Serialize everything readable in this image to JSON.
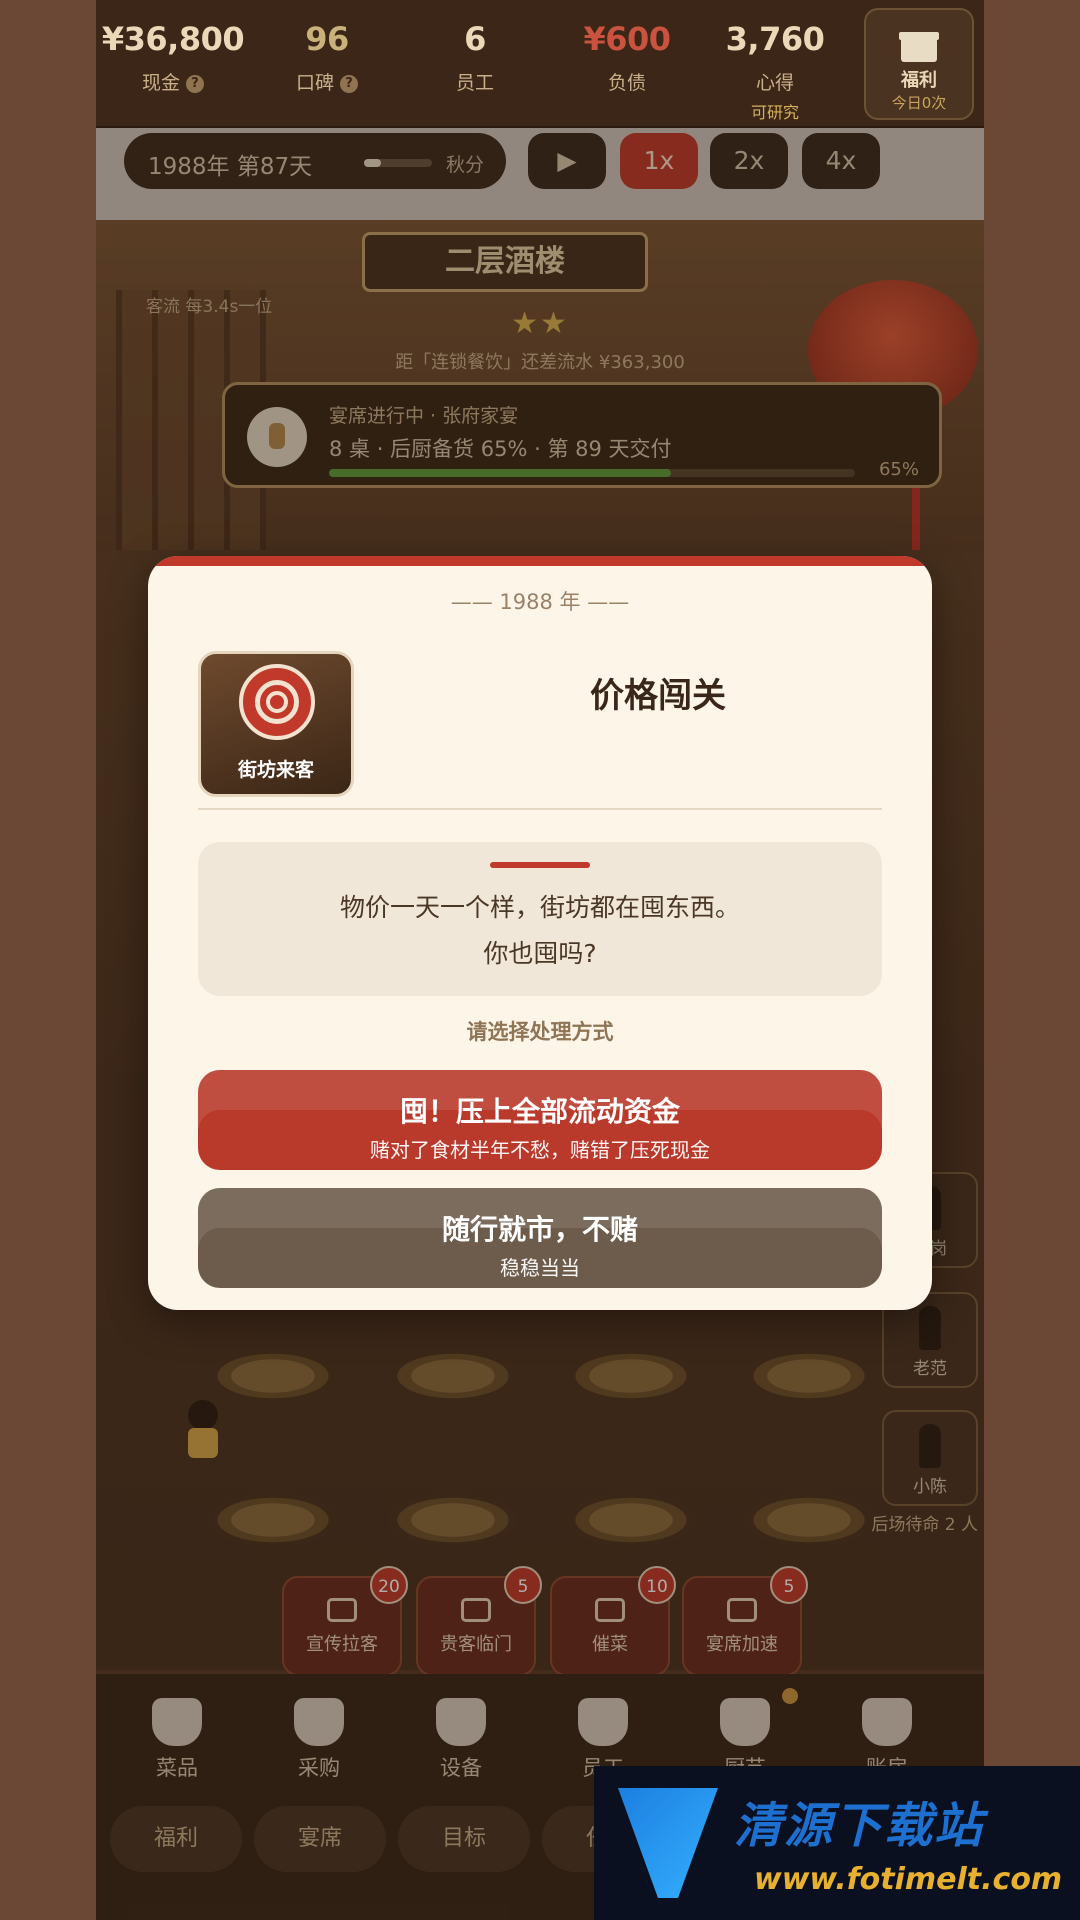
{
  "stats": [
    {
      "value": "¥36,800",
      "label": "现金",
      "help": "?"
    },
    {
      "value": "96",
      "label": "口碑",
      "help": "?"
    },
    {
      "value": "6",
      "label": "员工"
    },
    {
      "value": "¥600",
      "label": "负债"
    },
    {
      "value": "3,760",
      "label": "心得",
      "sub": "可研究"
    }
  ],
  "gift": {
    "label": "福利",
    "sub": "今日0次"
  },
  "timebar": {
    "date": "1988年 第87天",
    "season": "秋分",
    "season_progress": 0.25,
    "play": "▶",
    "speeds": [
      "1x",
      "2x",
      "4x"
    ],
    "active_speed": "1x"
  },
  "scene": {
    "restaurant_name": "二层酒楼",
    "traffic": "客流 每3.4s一位",
    "stars": "★★",
    "goal_gap": "距「连锁餐饮」还差流水 ¥363,300",
    "banquet": {
      "title": "宴席进行中 · 张府家宴",
      "detail": "8 桌 · 后厨备货 65% · 第 89 天交付",
      "progress": 0.65,
      "pct": "65%"
    },
    "staff": [
      {
        "name": "在岗"
      },
      {
        "name": "老范"
      },
      {
        "name": "小陈"
      }
    ],
    "waiting": "后场待命 2 人",
    "boosts": [
      {
        "label": "宣传拉客",
        "count": "20"
      },
      {
        "label": "贵客临门",
        "count": "5"
      },
      {
        "label": "催菜",
        "count": "10"
      },
      {
        "label": "宴席加速",
        "count": "5"
      }
    ]
  },
  "nav": {
    "items": [
      "菜品",
      "采购",
      "设备",
      "员工",
      "厨艺",
      "账房"
    ],
    "subtabs": [
      "福利",
      "宴席",
      "目标",
      "任务"
    ]
  },
  "modal": {
    "year": "—— 1988 年 ——",
    "image_caption": "街坊来客",
    "title": "价格闯关",
    "desc_line1": "物价一天一个样，街坊都在囤东西。",
    "desc_line2": "你也囤吗?",
    "prompt": "请选择处理方式",
    "choices": [
      {
        "main": "囤！压上全部流动资金",
        "sub": "赌对了食材半年不愁，赌错了压死现金"
      },
      {
        "main": "随行就市，不赌",
        "sub": "稳稳当当"
      }
    ]
  },
  "watermark": {
    "name": "清源下载站",
    "url": "www.fotimelt.com"
  },
  "colors": {
    "accent": "#c0392b",
    "modal_bg": "#fcf5e8",
    "top_bar": "#3b2618"
  }
}
